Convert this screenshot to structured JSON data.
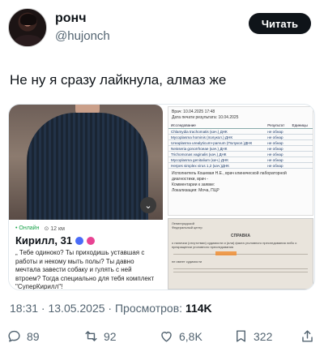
{
  "author": {
    "name": "ронч",
    "handle": "@hujonch",
    "read_button": "Читать"
  },
  "tweet": {
    "text": "Не ну я сразу лайкнула, алмаз же"
  },
  "media": {
    "profile_card": {
      "status_online": "• Онлайн",
      "distance": "⊙ 12 км",
      "name": "Кирилл, 31",
      "bio": "„ Тебе одиноко? Ты приходишь уставшая с работы и некому мыть полы? Ты давно мечтала завести собаку и гулять с ней втроем? Тогда специально для тебя комплект \"СуперКирилл\"!"
    },
    "lab_report": {
      "meta_1": "Врач:                               10.04.2025 17:48",
      "meta_2": "Дата печати результата:     10.04.2025",
      "col_test": "Исследование",
      "col_result": "Результат",
      "col_units": "Единицы",
      "rows": [
        {
          "test": "Chlamydia trachomatis (кач.) ДНК",
          "result": "не обнар"
        },
        {
          "test": "Mycoplasma hominis (полукол.) ДНК",
          "result": "не обнар"
        },
        {
          "test": "Ureaplasma urealyticum+parvum (Полукол.)ДНК",
          "result": "не обнар"
        },
        {
          "test": "Neisseria gonorrhoeae (кач.) ДНК",
          "result": "не обнар"
        },
        {
          "test": "Trichomonas vaginalis (кач.) ДНК",
          "result": "не обнар"
        },
        {
          "test": "Mycoplasma genitalium (кач.) ДНК",
          "result": "не обнар"
        },
        {
          "test": "Herpes simplex virus 1,2 (кач.)ДНК",
          "result": "не обнар"
        }
      ],
      "executor": "Исполнитель Кошевая Н.Е., врач клинической лабораторной диагностики, врач -",
      "comment": "Комментарии к заявке:",
      "material": "Локализация: Моча, ПЦР"
    },
    "certificate": {
      "org_line_1": "Ленинградской",
      "org_line_2": "Федеральный центр",
      "title": "СПРАВКА",
      "body_1": "о наличии (отсутствии) судимости и (или) факта уголовного преследования либо о прекращении уголовного преследования",
      "body_2": "не имеет судимости"
    }
  },
  "meta": {
    "time": "18:31 · 13.05.2025 · Просмотров: ",
    "views": "114K"
  },
  "actions": {
    "replies": "89",
    "retweets": "92",
    "likes": "6,8K",
    "bookmarks": "322"
  }
}
